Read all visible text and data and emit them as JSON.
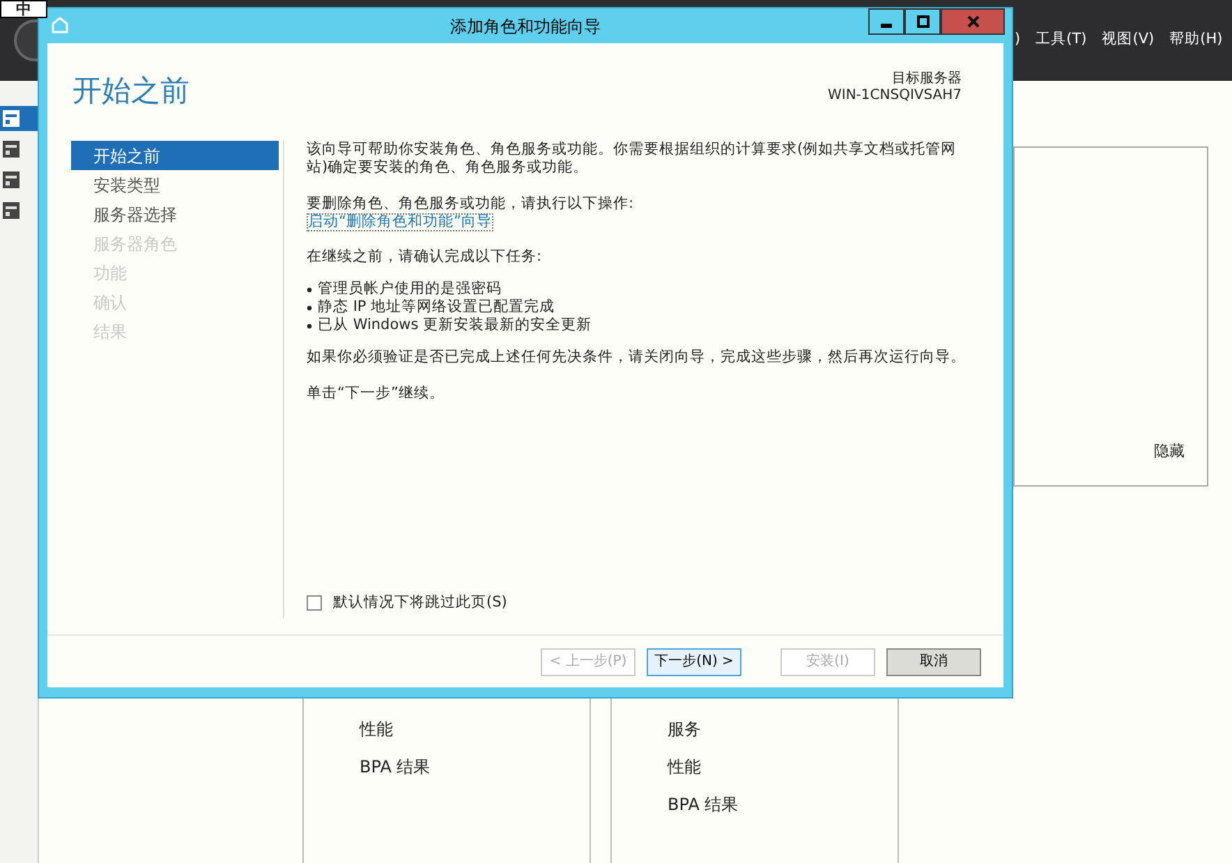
{
  "ime_indicator": "中",
  "menu": [
    ")",
    "工具(T)",
    "视图(V)",
    "帮助(H)"
  ],
  "sidebar": [
    {
      "selected": true
    },
    {
      "selected": false
    },
    {
      "selected": false
    },
    {
      "selected": false
    }
  ],
  "hide_link": "隐藏",
  "tiles": [
    {
      "items": [
        "性能",
        "BPA 结果"
      ]
    },
    {
      "items": [
        "服务",
        "性能",
        "BPA 结果"
      ]
    }
  ],
  "dialog": {
    "title": "添加角色和功能向导",
    "heading": "开始之前",
    "target_label": "目标服务器",
    "target_server": "WIN-1CNSQIVSAH7",
    "steps": [
      {
        "label": "开始之前",
        "selected": true,
        "disabled": false
      },
      {
        "label": "安装类型",
        "selected": false,
        "disabled": false
      },
      {
        "label": "服务器选择",
        "selected": false,
        "disabled": false
      },
      {
        "label": "服务器角色",
        "selected": false,
        "disabled": true
      },
      {
        "label": "功能",
        "selected": false,
        "disabled": true
      },
      {
        "label": "确认",
        "selected": false,
        "disabled": true
      },
      {
        "label": "结果",
        "selected": false,
        "disabled": true
      }
    ],
    "intro": "该向导可帮助你安装角色、角色服务或功能。你需要根据组织的计算要求(例如共享文档或托管网站)确定要安装的角色、角色服务或功能。",
    "remove_text": "要删除角色、角色服务或功能，请执行以下操作:",
    "remove_link": "启动“删除角色和功能”向导",
    "before_text": "在继续之前，请确认完成以下任务:",
    "tasks": [
      "管理员帐户使用的是强密码",
      "静态 IP 地址等网络设置已配置完成",
      "已从 Windows 更新安装最新的安全更新"
    ],
    "verify_text": "如果你必须验证是否已完成上述任何先决条件，请关闭向导，完成这些步骤，然后再次运行向导。",
    "continue_text": "单击“下一步”继续。",
    "skip_checkbox": {
      "label": "默认情况下将跳过此页(S)",
      "checked": false
    },
    "buttons": [
      {
        "label": "< 上一步(P)",
        "disabled": true,
        "default": false
      },
      {
        "label": "下一步(N) >",
        "disabled": false,
        "default": true
      },
      {
        "label": "安装(I)",
        "disabled": true,
        "default": false
      },
      {
        "label": "取消",
        "disabled": false,
        "default": false
      }
    ]
  }
}
